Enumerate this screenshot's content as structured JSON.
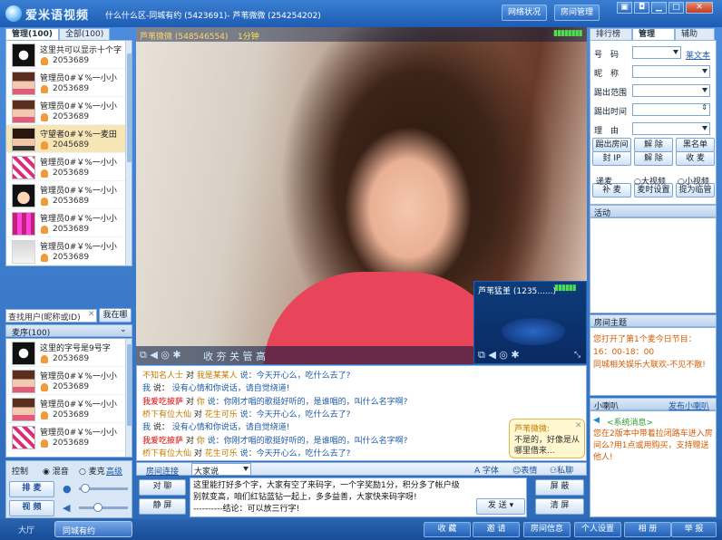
{
  "titlebar": {
    "app_name": "爱米语视频",
    "room_title": "什么什么区-同城有约 (5423691)- 芦苇微微 (254254202)",
    "network_label": "网络状况",
    "room_manage_label": "房间管理"
  },
  "left": {
    "tabs": [
      "管理(100)",
      "全部(100)"
    ],
    "users": [
      {
        "name": "这里共可以显示十个字",
        "id": "2053689",
        "avatar": "star"
      },
      {
        "name": "管理员0#￥%一小小",
        "id": "2053689",
        "avatar": "girl"
      },
      {
        "name": "管理员0#￥%一小小",
        "id": "2053689",
        "avatar": "girl"
      },
      {
        "name": "守望者0#￥%一麦田",
        "id": "2045689",
        "avatar": "girl2"
      },
      {
        "name": "管理员0#￥%一小小",
        "id": "2053689",
        "avatar": "pattern"
      },
      {
        "name": "管理员0#￥%一小小",
        "id": "2053689",
        "avatar": "cartoon"
      },
      {
        "name": "管理员0#￥%一小小",
        "id": "2053689",
        "avatar": "pattern2"
      },
      {
        "name": "管理员0#￥%一小小",
        "id": "2053689",
        "avatar": "grey"
      }
    ],
    "search_placeholder": "查找用户(昵称或ID)",
    "search_button": "我在哪",
    "queue_label": "麦序(100)",
    "queue": [
      {
        "name": "这里的字号是9号字",
        "id": "2053689",
        "avatar": "star"
      },
      {
        "name": "管理员0#￥%一小小",
        "id": "2053689",
        "avatar": "girl"
      },
      {
        "name": "管理员0#￥%一小小",
        "id": "2053689",
        "avatar": "girl"
      },
      {
        "name": "管理员0#￥%一小小",
        "id": "2053689",
        "avatar": "pattern"
      }
    ],
    "control_label": "控制",
    "mix_label": "混音",
    "mic_label": "麦克",
    "advanced_label": "高级",
    "mic_button": "排 麦",
    "video_button": "视 频"
  },
  "video": {
    "main_user": "芦苇微微 (548546554)",
    "main_time": "1分钟",
    "controls_label": "收 夯 关 管 高",
    "small_user": "芦苇猛堇 (1235......)",
    "signal": "signal-bars"
  },
  "chat": {
    "lines": [
      {
        "a": "不知名人士",
        "to": "对",
        "b": "我是某某人",
        "say": "说：今天开心么，吃什么去了?"
      },
      {
        "a": "我",
        "to": "说：",
        "b": "",
        "say": "没有心情和你说话，请自觉绕道!"
      },
      {
        "a": "我爱吃披萨",
        "to": "对",
        "b": "你",
        "say": "说：你刚才唱的歌挺好听的，是谁唱的，叫什么名字啊?"
      },
      {
        "a": "桥下有位大仙",
        "to": "对",
        "b": "花生可乐",
        "say": "说：今天开心么，吃什么去了?"
      },
      {
        "a": "我",
        "to": "说：",
        "b": "",
        "say": "没有心情和你说话，请自觉绕道!"
      },
      {
        "a": "我爱吃披萨",
        "to": "对",
        "b": "你",
        "say": "说：你刚才唱的歌挺好听的，是谁唱的，叫什么名字啊?"
      },
      {
        "a": "桥下有位大仙",
        "to": "对",
        "b": "花生可乐",
        "say": "说：今天开心么，吃什么去了?"
      }
    ],
    "popup_name": "芦苇微微:",
    "popup_text": "不是的，好像是从哪里借来..."
  },
  "input": {
    "room_connect": "房间连接",
    "target": "大家说",
    "font_label": "字体",
    "emoji_label": "表情",
    "private_label": "私聊",
    "public_button": "对 聊",
    "mute_button": "静 屏",
    "text": "这里能打好多个字，大家有空了来码字，一个字奖励1分，积分多了帐户级别就变高，咱们红钻蓝钻一起上，多多益善，大家快来码字呀!\n----------结论：可以放三行字!",
    "send_button": "发 送",
    "block_button": "屏 蔽",
    "clear_button": "清 屏"
  },
  "right": {
    "tabs": [
      "排行榜",
      "管理",
      "辅助"
    ],
    "fields": [
      {
        "label": "号　码",
        "type": "select"
      },
      {
        "label": "昵　称",
        "type": "select"
      },
      {
        "label": "踢出范围",
        "type": "select"
      },
      {
        "label": "踢出时间",
        "type": "spin"
      },
      {
        "label": "理　由",
        "type": "select"
      }
    ],
    "plain_text_link": "莱文本",
    "buttons_row1": [
      "踢出房间",
      "解 除",
      "黑名单"
    ],
    "buttons_row2": [
      "封 IP",
      "解 除",
      "收 麦"
    ],
    "mic_label": "递麦",
    "big_video": "大视频",
    "small_video": "小视频",
    "buttons_row3": [
      "补 麦",
      "麦时设置",
      "提为临管"
    ],
    "activity_label": "活动",
    "topic_label": "房间主题",
    "topic_lines": [
      "您打开了第1个麦今日节目：",
      "16：00-18：00",
      "同城相关娱乐大联欢-不见不散!"
    ],
    "horn_label": "小喇叭",
    "horn_link": "发布小喇叭",
    "horn_title": "<系统消息>",
    "horn_text": "您在2版本中带着拉闭路车进入房间么?用1点或用购买，支持赠送他人!"
  },
  "bottombar": {
    "lobby": "大厅",
    "room": "同城有约",
    "buttons": [
      "收 藏",
      "邀 请",
      "房间信息",
      "个人设置",
      "相 册",
      "举 报"
    ]
  }
}
